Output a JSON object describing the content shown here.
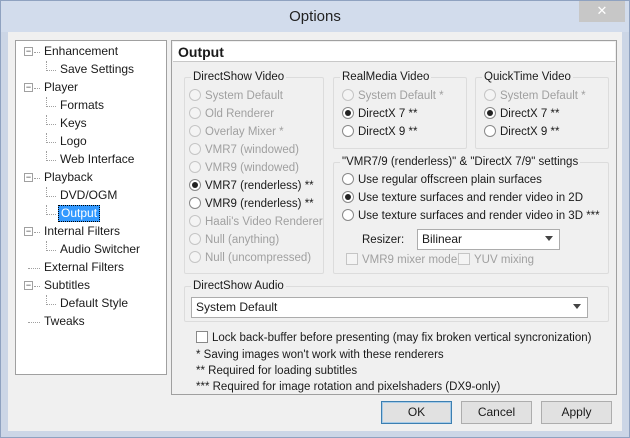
{
  "window": {
    "title": "Options",
    "close_glyph": "✕"
  },
  "tree": {
    "items": [
      {
        "label": "Enhancement",
        "level": 0,
        "expander": "−"
      },
      {
        "label": "Save Settings",
        "level": 1
      },
      {
        "label": "Player",
        "level": 0,
        "expander": "−"
      },
      {
        "label": "Formats",
        "level": 1
      },
      {
        "label": "Keys",
        "level": 1
      },
      {
        "label": "Logo",
        "level": 1
      },
      {
        "label": "Web Interface",
        "level": 1
      },
      {
        "label": "Playback",
        "level": 0,
        "expander": "−"
      },
      {
        "label": "DVD/OGM",
        "level": 1
      },
      {
        "label": "Output",
        "level": 1,
        "selected": true
      },
      {
        "label": "Internal Filters",
        "level": 0,
        "expander": "−"
      },
      {
        "label": "Audio Switcher",
        "level": 1
      },
      {
        "label": "External Filters",
        "level": 0
      },
      {
        "label": "Subtitles",
        "level": 0,
        "expander": "−"
      },
      {
        "label": "Default Style",
        "level": 1
      },
      {
        "label": "Tweaks",
        "level": 0
      }
    ]
  },
  "panel": {
    "title": "Output",
    "directshow_video": {
      "title": "DirectShow Video",
      "options": [
        {
          "label": "System Default",
          "enabled": false,
          "checked": false
        },
        {
          "label": "Old Renderer",
          "enabled": false,
          "checked": false
        },
        {
          "label": "Overlay Mixer *",
          "enabled": false,
          "checked": false
        },
        {
          "label": "VMR7 (windowed)",
          "enabled": false,
          "checked": false
        },
        {
          "label": "VMR9 (windowed)",
          "enabled": false,
          "checked": false
        },
        {
          "label": "VMR7 (renderless) **",
          "enabled": true,
          "checked": true
        },
        {
          "label": "VMR9 (renderless) **",
          "enabled": true,
          "checked": false
        },
        {
          "label": "Haali's Video Renderer",
          "enabled": false,
          "checked": false
        },
        {
          "label": "Null (anything)",
          "enabled": false,
          "checked": false
        },
        {
          "label": "Null (uncompressed)",
          "enabled": false,
          "checked": false
        }
      ]
    },
    "realmedia_video": {
      "title": "RealMedia Video",
      "options": [
        {
          "label": "System Default *",
          "enabled": false,
          "checked": false
        },
        {
          "label": "DirectX 7 **",
          "enabled": true,
          "checked": true
        },
        {
          "label": "DirectX 9 **",
          "enabled": true,
          "checked": false
        }
      ]
    },
    "quicktime_video": {
      "title": "QuickTime Video",
      "options": [
        {
          "label": "System Default *",
          "enabled": false,
          "checked": false
        },
        {
          "label": "DirectX 7 **",
          "enabled": true,
          "checked": true
        },
        {
          "label": "DirectX 9 **",
          "enabled": true,
          "checked": false
        }
      ]
    },
    "vmr_settings": {
      "title": "\"VMR7/9 (renderless)\" & \"DirectX 7/9\" settings",
      "options": [
        {
          "label": "Use regular offscreen plain surfaces",
          "checked": false
        },
        {
          "label": "Use texture surfaces and render video in 2D",
          "checked": true
        },
        {
          "label": "Use texture surfaces and render video in 3D ***",
          "checked": false
        }
      ],
      "resizer_label": "Resizer:",
      "resizer_value": "Bilinear",
      "vmr9_mixer_mode": "VMR9 mixer mode",
      "yuv_mixing": "YUV mixing"
    },
    "directshow_audio": {
      "title": "DirectShow Audio",
      "value": "System Default"
    },
    "lock_backbuffer": "Lock back-buffer before presenting (may fix broken vertical syncronization)",
    "notes": [
      "* Saving images won't work with these renderers",
      "** Required for loading subtitles",
      "*** Required for image rotation and pixelshaders (DX9-only)"
    ]
  },
  "buttons": {
    "ok": "OK",
    "cancel": "Cancel",
    "apply": "Apply"
  }
}
